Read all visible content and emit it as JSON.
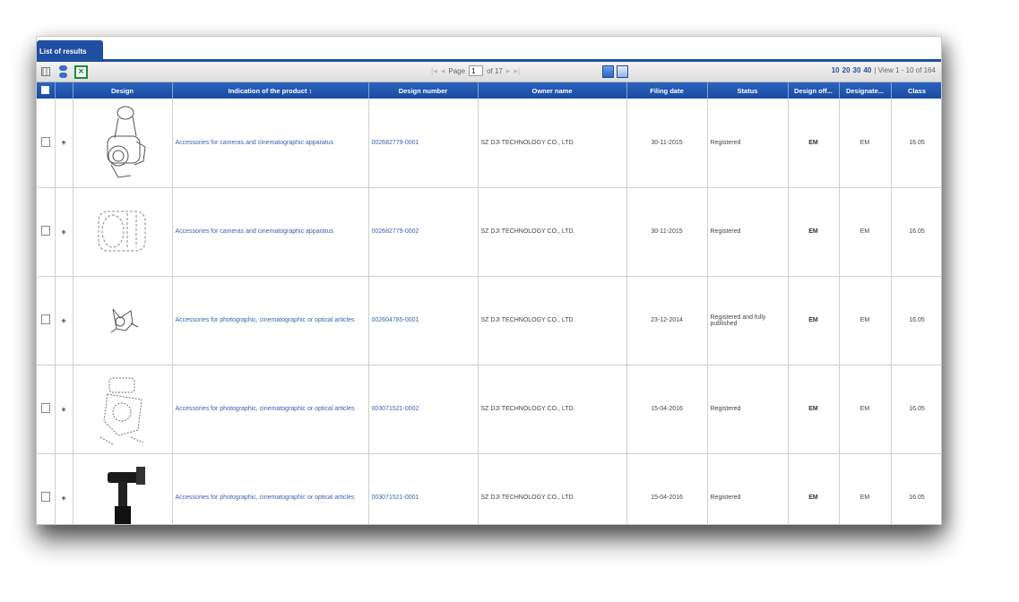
{
  "tab": {
    "label": "List of results"
  },
  "pager": {
    "page_label": "Page",
    "page_value": "1",
    "of_label": "of 17"
  },
  "rows_per_page": [
    "10",
    "20",
    "30",
    "40"
  ],
  "view_text": "| View 1 - 10 of 164",
  "columns": [
    "Design",
    "Indication of the product ↕",
    "Design number",
    "Owner name",
    "Filing date",
    "Status",
    "Design off...",
    "Designate...",
    "Class"
  ],
  "rows": [
    {
      "design_icon": "camera-gimbal-drawing",
      "product": "Accessories for cameras and cinematographic apparatus",
      "number": "002682779-0001",
      "owner": "SZ DJI TECHNOLOGY CO., LTD.",
      "date": "30-11-2015",
      "status": "Registered",
      "office": "EM",
      "designated": "EM",
      "class": "16.05"
    },
    {
      "design_icon": "camera-housing-drawing",
      "product": "Accessories for cameras and cinematographic apparatus",
      "number": "002682779-0002",
      "owner": "SZ DJI TECHNOLOGY CO., LTD.",
      "date": "30-11-2015",
      "status": "Registered",
      "office": "EM",
      "designated": "EM",
      "class": "16.05"
    },
    {
      "design_icon": "gimbal-arm-drawing",
      "product": "Accessories for photographic, cinematographic or optical articles",
      "number": "002604785-0001",
      "owner": "SZ DJI TECHNOLOGY CO., LTD.",
      "date": "23-12-2014",
      "status": "Registered and fully published",
      "office": "EM",
      "designated": "EM",
      "class": "16.05"
    },
    {
      "design_icon": "gimbal-assembly-drawing",
      "product": "Accessories for photographic, cinematographic or optical articles",
      "number": "003071521-0002",
      "owner": "SZ DJI TECHNOLOGY CO., LTD.",
      "date": "15-04-2016",
      "status": "Registered",
      "office": "EM",
      "designated": "EM",
      "class": "16.05"
    },
    {
      "design_icon": "handheld-gimbal-photo",
      "product": "Accessories for photographic, cinematographic or optical articles",
      "number": "003071521-0001",
      "owner": "SZ DJI TECHNOLOGY CO., LTD.",
      "date": "15-04-2016",
      "status": "Registered",
      "office": "EM",
      "designated": "EM",
      "class": "16.05"
    }
  ]
}
